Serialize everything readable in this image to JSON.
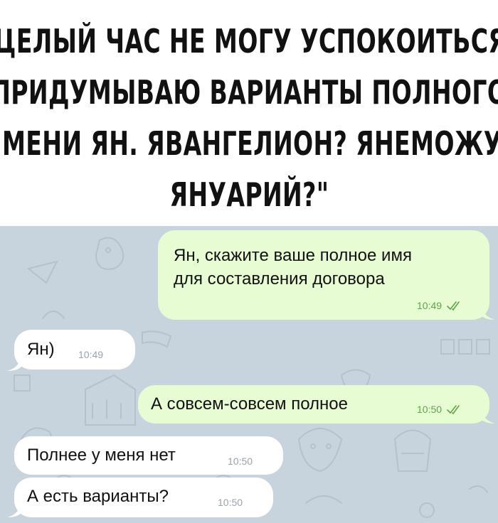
{
  "headline": {
    "lines": [
      "\"ЦЕЛЫЙ ЧАС НЕ МОГУ УСПОКОИТЬСЯ.",
      "ПРИДУМЫВАЮ ВАРИАНТЫ ПОЛНОГО",
      "ИМЕНИ ЯН. ЯВАНГЕЛИОН? ЯНЕМОЖУ?",
      "ЯНУАРИЙ?\""
    ]
  },
  "chat": {
    "colors": {
      "background": "#c7d3dd",
      "outgoing_bubble": "#e7fcd2",
      "incoming_bubble": "#ffffff",
      "outgoing_time": "#5fa34d",
      "incoming_time": "#9aa3ab"
    },
    "messages": [
      {
        "direction": "outgoing",
        "text_lines": [
          "Ян, скажите ваше полное имя",
          "для составления договора"
        ],
        "time": "10:49",
        "status_icon": "double-check-icon"
      },
      {
        "direction": "incoming",
        "text": "Ян)",
        "time": "10:49"
      },
      {
        "direction": "outgoing",
        "text": "А совсем-совсем полное",
        "time": "10:50",
        "status_icon": "double-check-icon"
      },
      {
        "direction": "incoming",
        "text": "Полнее у меня нет",
        "time": "10:50"
      },
      {
        "direction": "incoming",
        "text": "А есть варианты?",
        "time": "10:50"
      }
    ]
  }
}
